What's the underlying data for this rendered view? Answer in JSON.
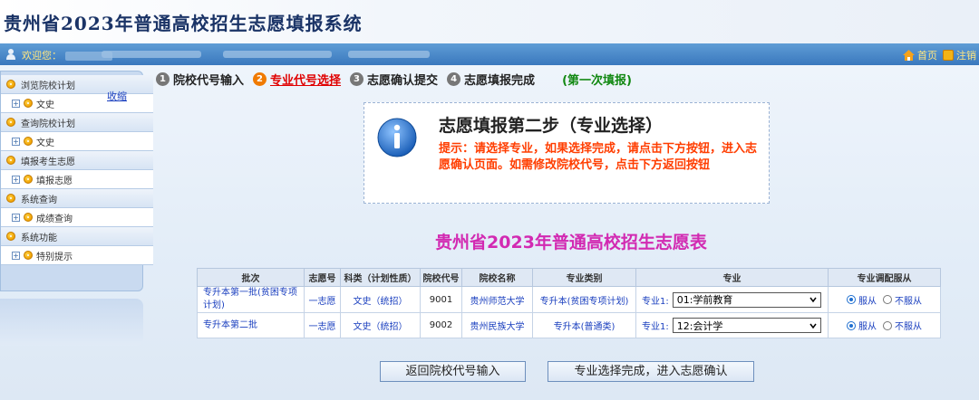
{
  "app": {
    "title": "贵州省2023年普通高校招生志愿填报系统"
  },
  "topbar": {
    "welcome_label": "欢迎您：",
    "home_label": "首页",
    "logout_label": "注销"
  },
  "sidebar": {
    "collapse_label": "收缩",
    "groups": [
      {
        "label": "浏览院校计划",
        "sub": "文史"
      },
      {
        "label": "查询院校计划",
        "sub": "文史"
      },
      {
        "label": "填报考生志愿",
        "sub": "填报志愿"
      },
      {
        "label": "系统查询",
        "sub": "成绩查询"
      },
      {
        "label": "系统功能",
        "sub": "特别提示"
      }
    ]
  },
  "steps": {
    "items": [
      {
        "num": "1",
        "label": "院校代号输入"
      },
      {
        "num": "2",
        "label": "专业代号选择"
      },
      {
        "num": "3",
        "label": "志愿确认提交"
      },
      {
        "num": "4",
        "label": "志愿填报完成"
      }
    ],
    "round_label": "(第一次填报)"
  },
  "notice": {
    "title": "志愿填报第二步（专业选择）",
    "text": "提示：请选择专业，如果选择完成，请点击下方按钮，进入志愿确认页面。如需修改院校代号，点击下方返回按钮"
  },
  "form_title": "贵州省2023年普通高校招生志愿表",
  "table": {
    "headers": [
      "批次",
      "志愿号",
      "科类（计划性质）",
      "院校代号",
      "院校名称",
      "专业类别",
      "专业",
      "专业调配服从"
    ],
    "rows": [
      {
        "batch": "专升本第一批(贫困专项计划)",
        "vol_no": "一志愿",
        "category": "文史（统招）",
        "code": "9001",
        "school": "贵州师范大学",
        "major_type": "专升本(贫困专项计划)",
        "major_prefix": "专业1:",
        "major_value": "01:学前教育",
        "obey_label": "服从",
        "not_obey_label": "不服从"
      },
      {
        "batch": "专升本第二批",
        "vol_no": "一志愿",
        "category": "文史（统招）",
        "code": "9002",
        "school": "贵州民族大学",
        "major_type": "专升本(普通类)",
        "major_prefix": "专业1:",
        "major_value": "12:会计学",
        "obey_label": "服从",
        "not_obey_label": "不服从"
      }
    ]
  },
  "buttons": {
    "back_label": "返回院校代号输入",
    "confirm_label": "专业选择完成，进入志愿确认"
  }
}
